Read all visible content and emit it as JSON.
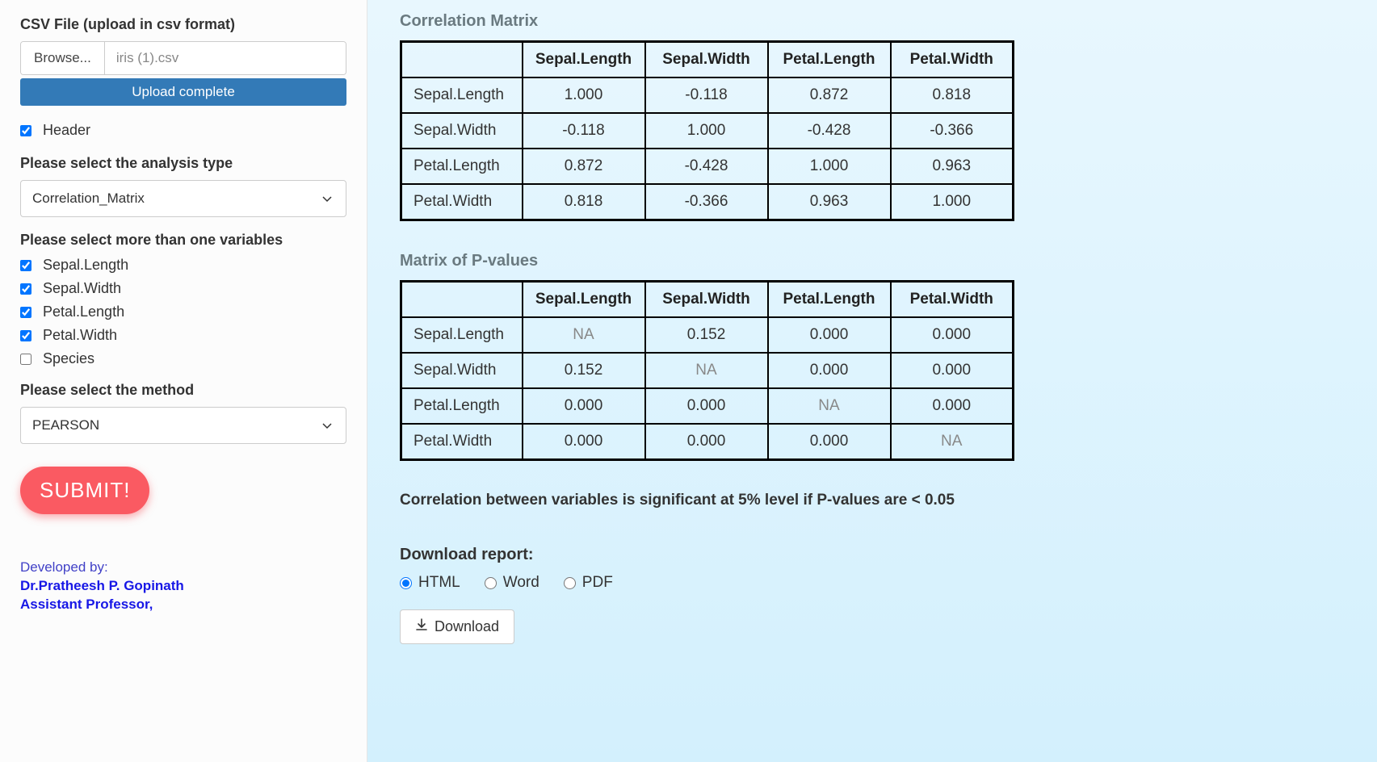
{
  "sidebar": {
    "csv_label": "CSV File (upload in csv format)",
    "browse_label": "Browse...",
    "file_name": "iris (1).csv",
    "upload_status": "Upload complete",
    "header_label": "Header",
    "header_checked": true,
    "analysis_type": {
      "label": "Please select the analysis type",
      "value": "Correlation_Matrix"
    },
    "variables": {
      "label": "Please select more than one variables",
      "items": [
        {
          "label": "Sepal.Length",
          "checked": true
        },
        {
          "label": "Sepal.Width",
          "checked": true
        },
        {
          "label": "Petal.Length",
          "checked": true
        },
        {
          "label": "Petal.Width",
          "checked": true
        },
        {
          "label": "Species",
          "checked": false
        }
      ]
    },
    "method": {
      "label": "Please select the method",
      "value": "PEARSON"
    },
    "submit_label": "SUBMIT!",
    "credits": {
      "developed_by": "Developed by:",
      "name": "Dr.Pratheesh P. Gopinath",
      "role": "Assistant Professor,"
    }
  },
  "main": {
    "corr_title": "Correlation Matrix",
    "headers": [
      "Sepal.Length",
      "Sepal.Width",
      "Petal.Length",
      "Petal.Width"
    ],
    "corr_rows": [
      {
        "name": "Sepal.Length",
        "vals": [
          "1.000",
          "-0.118",
          "0.872",
          "0.818"
        ]
      },
      {
        "name": "Sepal.Width",
        "vals": [
          "-0.118",
          "1.000",
          "-0.428",
          "-0.366"
        ]
      },
      {
        "name": "Petal.Length",
        "vals": [
          "0.872",
          "-0.428",
          "1.000",
          "0.963"
        ]
      },
      {
        "name": "Petal.Width",
        "vals": [
          "0.818",
          "-0.366",
          "0.963",
          "1.000"
        ]
      }
    ],
    "pval_title": "Matrix of P-values",
    "pval_rows": [
      {
        "name": "Sepal.Length",
        "vals": [
          "NA",
          "0.152",
          "0.000",
          "0.000"
        ]
      },
      {
        "name": "Sepal.Width",
        "vals": [
          "0.152",
          "NA",
          "0.000",
          "0.000"
        ]
      },
      {
        "name": "Petal.Length",
        "vals": [
          "0.000",
          "0.000",
          "NA",
          "0.000"
        ]
      },
      {
        "name": "Petal.Width",
        "vals": [
          "0.000",
          "0.000",
          "0.000",
          "NA"
        ]
      }
    ],
    "sig_note": "Correlation between variables is significant at 5% level if P-values are < 0.05",
    "download": {
      "title": "Download report:",
      "options": [
        {
          "label": "HTML",
          "checked": true
        },
        {
          "label": "Word",
          "checked": false
        },
        {
          "label": "PDF",
          "checked": false
        }
      ],
      "button_label": "Download"
    }
  }
}
